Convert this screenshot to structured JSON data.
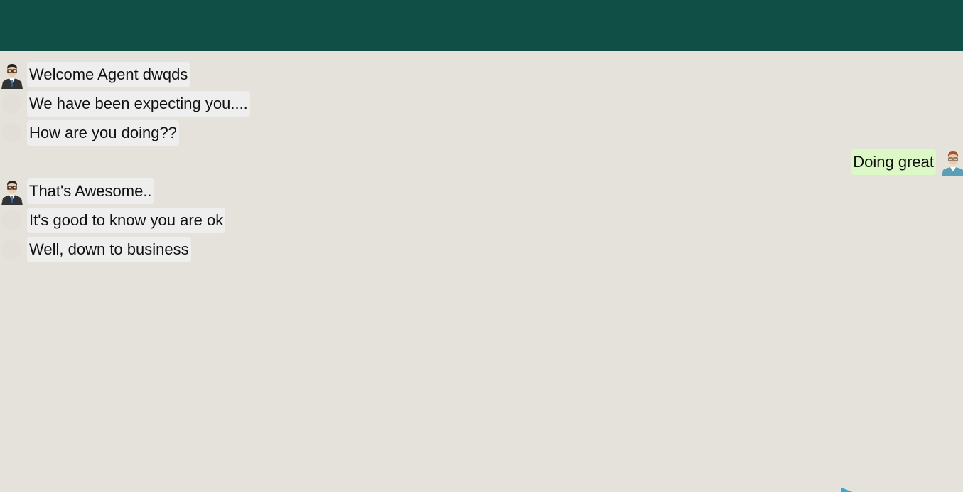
{
  "conversation": {
    "messages": [
      {
        "from": "agent",
        "avatar": "agent-avatar-icon",
        "text": "Welcome Agent dwqds"
      },
      {
        "from": "agent",
        "avatar": "",
        "text": "We have been expecting you...."
      },
      {
        "from": "agent",
        "avatar": "",
        "text": "How are you doing??"
      },
      {
        "from": "user",
        "avatar": "user-avatar-icon",
        "text": "Doing great"
      },
      {
        "from": "agent",
        "avatar": "agent-avatar-icon",
        "text": "That's Awesome.."
      },
      {
        "from": "agent",
        "avatar": "",
        "text": "It's good to know you are ok"
      },
      {
        "from": "agent",
        "avatar": "",
        "text": "Well, down to business"
      }
    ]
  },
  "colors": {
    "header": "#0f4f46",
    "background": "#e5e1db",
    "received_bubble": "#eeeeee",
    "sent_bubble": "#dcf8c6",
    "send_icon": "#3aa7d2"
  },
  "icons": {
    "send": "send-icon"
  }
}
